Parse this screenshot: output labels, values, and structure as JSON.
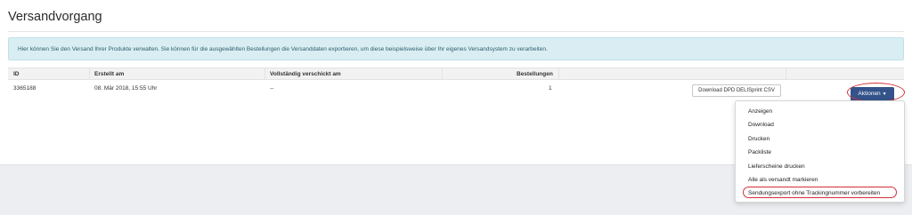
{
  "page": {
    "title": "Versandvorgang"
  },
  "info": {
    "text": "Hier können Sie den Versand Ihrer Produkte verwalten. Sie können für die ausgewählten Bestellungen die Versanddaten exportieren, um diese beispielsweise über Ihr eigenes Versandsystem zu verarbeiten."
  },
  "table": {
    "headers": {
      "id": "ID",
      "created": "Erstellt am",
      "shipped": "Vollständig verschickt am",
      "orders": "Bestellungen"
    },
    "rows": [
      {
        "id": "3365188",
        "created": "08. Mär 2018, 15:55 Uhr",
        "shipped": "--",
        "orders": "1",
        "download_label": "Download DPD DELISprint CSV",
        "actions_label": "Aktionen"
      }
    ]
  },
  "actions_menu": {
    "items": [
      "Anzeigen",
      "Download",
      "Drucken",
      "Packliste",
      "Lieferscheine drucken",
      "Alle als versandt markieren",
      "Sendungsexport ohne Trackingnummer vorbereiten"
    ]
  },
  "colors": {
    "primary_button": "#34538a",
    "info_background": "#d9edf3",
    "highlight": "#d2313a"
  },
  "icons": {
    "actions_caret": "caret-down-icon"
  }
}
